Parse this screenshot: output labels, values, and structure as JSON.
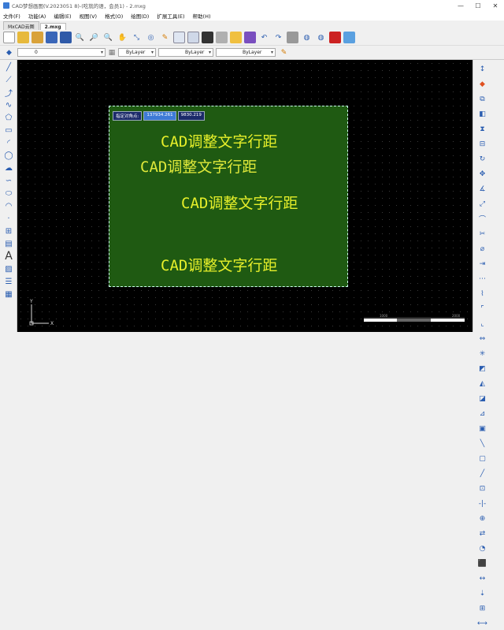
{
  "window": {
    "title": "CAD梦想画图(V.2023051 8)-(吃就的语，会员1) - 2.mxg",
    "controls": [
      "—",
      "☐",
      "✕"
    ]
  },
  "menu": [
    "文件(F)",
    "功能(A)",
    "编辑(E)",
    "视图(V)",
    "格式(O)",
    "绘图(D)",
    "扩展工具(E)",
    "帮助(H)"
  ],
  "tabs": [
    {
      "label": "MxCAD云图",
      "active": false
    },
    {
      "label": "2.mxg",
      "active": true
    }
  ],
  "properties": {
    "layer_value": "0",
    "color_value": "ByLayer",
    "linetype_value": "ByLayer",
    "lineweight_value": "ByLayer"
  },
  "canvas": {
    "coord_label": "指定对角点:",
    "coord_x": "137934.261",
    "coord_y": "9830.219",
    "texts": [
      "CAD调整文字行距",
      "CAD调整文字行距",
      "CAD调整文字行距",
      "CAD调整文字行距"
    ],
    "ucs_x": "X",
    "ucs_y": "Y",
    "scale_labels": [
      "1000",
      "2000"
    ]
  },
  "colors": {
    "background": "#000000",
    "sheet": "#1f5a12",
    "text": "#e6ef2a"
  }
}
